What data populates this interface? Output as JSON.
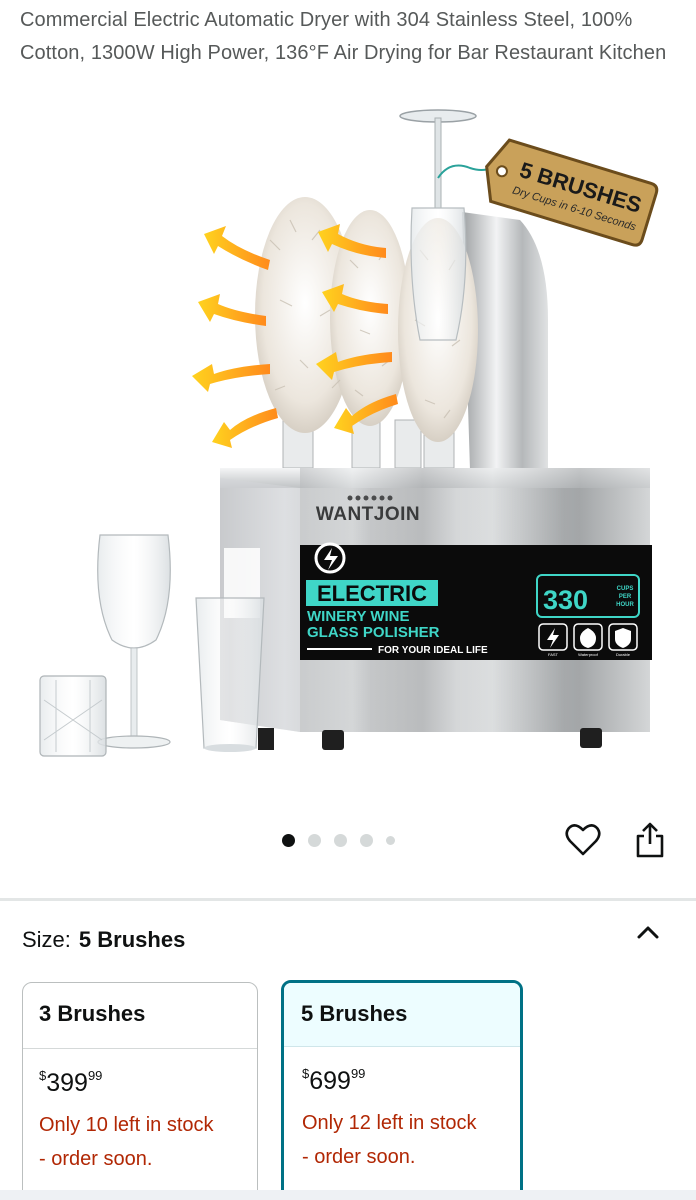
{
  "product": {
    "title": "Commercial Electric Automatic Dryer with 304 Stainless Steel, 100% Cotton, 1300W High Power, 136°F Air Drying for Bar Restaurant Kitchen"
  },
  "image": {
    "tag_title": "5 BRUSHES",
    "tag_subtitle": "Dry Cups in 6-10 Seconds",
    "brand": "WANTJOIN",
    "panel_line1": "ELECTRIC",
    "panel_line2": "WINERY WINE",
    "panel_line3": "GLASS POLISHER",
    "panel_tagline": "FOR YOUR IDEAL LIFE",
    "capacity_number": "330",
    "capacity_unit_1": "CUPS",
    "capacity_unit_2": "PER",
    "capacity_unit_3": "HOUR",
    "badge_1": "FAST",
    "badge_2": "Waterproof",
    "badge_3": "Durable"
  },
  "gallery": {
    "total_dots": 5,
    "active_index": 0
  },
  "icons": {
    "wishlist": "heart-icon",
    "share": "share-icon",
    "collapse": "chevron-up-icon"
  },
  "size": {
    "label": "Size:",
    "selected": "5 Brushes"
  },
  "options": [
    {
      "name": "3 Brushes",
      "currency": "$",
      "price_whole": "399",
      "price_fraction": "99",
      "stock_line1": "Only 10 left in stock",
      "stock_line2": "- order soon.",
      "selected": false
    },
    {
      "name": "5 Brushes",
      "currency": "$",
      "price_whole": "699",
      "price_fraction": "99",
      "stock_line1": "Only 12 left in stock",
      "stock_line2": "- order soon.",
      "selected": true
    }
  ],
  "colors": {
    "accent": "#007185",
    "stock_red": "#b12704",
    "selected_bg": "#edfdff",
    "panel_teal": "#3fd6c7"
  }
}
